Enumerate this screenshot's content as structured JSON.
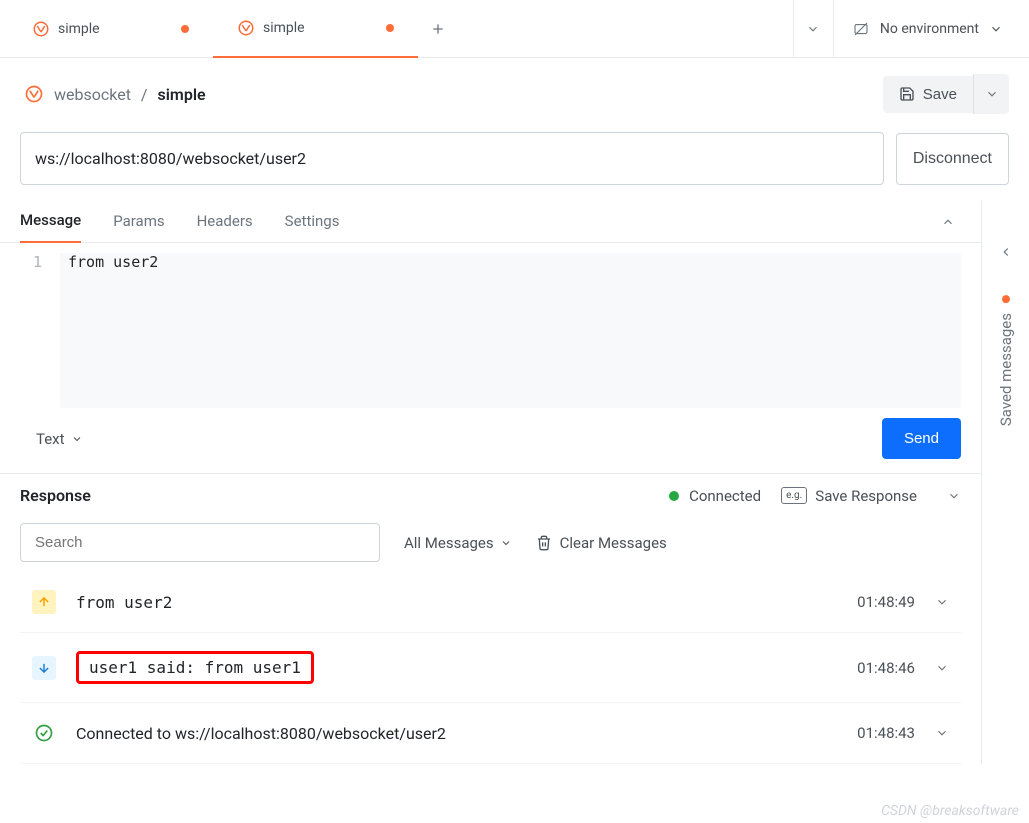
{
  "tabs": [
    {
      "label": "simple",
      "active": false,
      "dirty": true
    },
    {
      "label": "simple",
      "active": true,
      "dirty": true
    }
  ],
  "environment": {
    "label": "No environment"
  },
  "breadcrumb": {
    "parent": "websocket",
    "sep": "/",
    "current": "simple"
  },
  "save": {
    "label": "Save"
  },
  "url": {
    "value": "ws://localhost:8080/websocket/user2"
  },
  "disconnect": {
    "label": "Disconnect"
  },
  "req_tabs": [
    {
      "label": "Message",
      "active": true
    },
    {
      "label": "Params",
      "active": false
    },
    {
      "label": "Headers",
      "active": false
    },
    {
      "label": "Settings",
      "active": false
    }
  ],
  "editor": {
    "line": "1",
    "text": "from user2"
  },
  "format": {
    "label": "Text"
  },
  "send": {
    "label": "Send"
  },
  "sidebar": {
    "label": "Saved messages"
  },
  "response": {
    "title": "Response",
    "status": "Connected",
    "save_label": "Save Response",
    "search_placeholder": "Search",
    "filter": "All Messages",
    "clear": "Clear Messages",
    "messages": [
      {
        "type": "up",
        "text": "from user2",
        "time": "01:48:49"
      },
      {
        "type": "down",
        "text": "user1 said: from user1",
        "time": "01:48:46",
        "highlighted": true
      },
      {
        "type": "check",
        "text": "Connected to ws://localhost:8080/websocket/user2",
        "time": "01:48:43"
      }
    ]
  },
  "watermark": "CSDN @breaksoftware"
}
